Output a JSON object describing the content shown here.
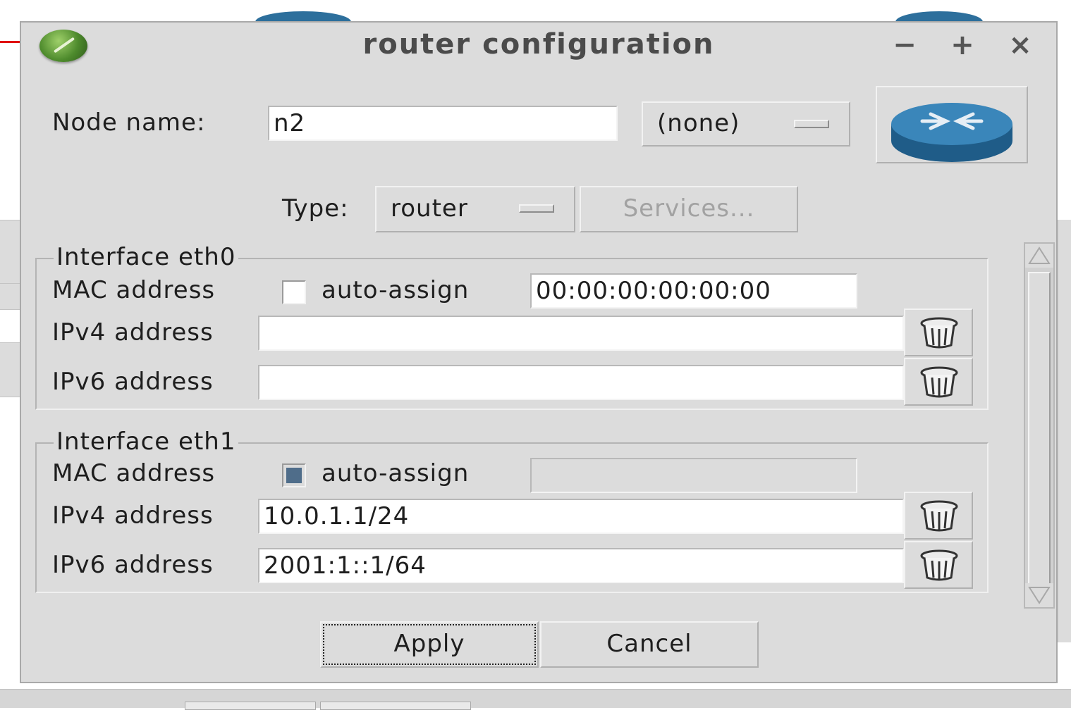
{
  "window": {
    "title": "router configuration",
    "minimize_symbol": "−",
    "maximize_symbol": "+",
    "close_symbol": "×"
  },
  "node": {
    "name_label": "Node name:",
    "name_value": "n2",
    "server_menu_value": "(none)",
    "type_label": "Type:",
    "type_value": "router",
    "services_label": "Services...",
    "icon": "router-icon"
  },
  "interfaces": [
    {
      "title": "Interface eth0",
      "mac_label": "MAC address",
      "auto_assign_label": "auto-assign",
      "auto_assign_checked": false,
      "mac_value": "00:00:00:00:00:00",
      "ipv4_label": "IPv4 address",
      "ipv4_value": "",
      "ipv6_label": "IPv6 address",
      "ipv6_value": ""
    },
    {
      "title": "Interface eth1",
      "mac_label": "MAC address",
      "auto_assign_label": "auto-assign",
      "auto_assign_checked": true,
      "mac_value": "",
      "ipv4_label": "IPv4 address",
      "ipv4_value": "10.0.1.1/24",
      "ipv6_label": "IPv6 address",
      "ipv6_value": "2001:1::1/64"
    }
  ],
  "actions": {
    "apply_label": "Apply",
    "cancel_label": "Cancel"
  },
  "colors": {
    "dialog_bg": "#dcdcdc",
    "router_icon": "#2d6f9c",
    "checkbox_checked": "#4f6d8a"
  }
}
